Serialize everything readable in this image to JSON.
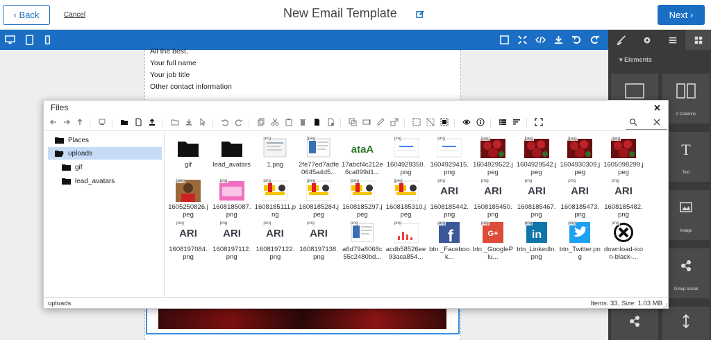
{
  "header": {
    "back_label": "‹ Back",
    "cancel_label": "Cancel",
    "title": "New Email Template",
    "next_label": "Next ›"
  },
  "email": {
    "signature_lines": [
      "All the best,",
      "Your full name",
      "Your job title",
      "Other contact information"
    ]
  },
  "right_panel": {
    "elements_header": "▾  Elements",
    "blocks": [
      {
        "label": ""
      },
      {
        "label": "2 Columns"
      },
      {
        "label": ""
      },
      {
        "label": "Text"
      },
      {
        "label": ""
      },
      {
        "label": "Image"
      },
      {
        "label": ""
      },
      {
        "label": "Group Social"
      }
    ]
  },
  "dialog": {
    "title": "Files",
    "tree": {
      "places": "Places",
      "uploads": "uploads",
      "children": [
        "gif",
        "lead_avatars"
      ]
    },
    "files": [
      {
        "name": "gif",
        "ext": "",
        "kind": "folder"
      },
      {
        "name": "lead_avatars",
        "ext": "",
        "kind": "folder"
      },
      {
        "name": "1.png",
        "ext": "png",
        "kind": "doc"
      },
      {
        "name": "2fe77ed7adfe0645a4d5...",
        "ext": "jpeg",
        "kind": "doc2"
      },
      {
        "name": "17abcf4c212e6ca099d1...",
        "ext": "",
        "kind": "ata"
      },
      {
        "name": "1604929350.png",
        "ext": "png",
        "kind": "web"
      },
      {
        "name": "1604929415.png",
        "ext": "png",
        "kind": "web"
      },
      {
        "name": "1604929522.jpeg",
        "ext": "jpeg",
        "kind": "rose"
      },
      {
        "name": "1604929542.jpeg",
        "ext": "jpeg",
        "kind": "rose"
      },
      {
        "name": "1604930309.jpeg",
        "ext": "jpeg",
        "kind": "rose"
      },
      {
        "name": "1605098299.jpeg",
        "ext": "jpeg",
        "kind": "rose"
      },
      {
        "name": "1605250826.jpeg",
        "ext": "jpeg",
        "kind": "person"
      },
      {
        "name": "1608185087.png",
        "ext": "png",
        "kind": "pink"
      },
      {
        "name": "1608185111.png",
        "ext": "png",
        "kind": "promo"
      },
      {
        "name": "1608185284.jpeg",
        "ext": "jpeg",
        "kind": "promo"
      },
      {
        "name": "1608185297.jpeg",
        "ext": "jpeg",
        "kind": "promo"
      },
      {
        "name": "1608185310.jpeg",
        "ext": "jpeg",
        "kind": "promo"
      },
      {
        "name": "1608185442.png",
        "ext": "png",
        "kind": "ari"
      },
      {
        "name": "1608185450.png",
        "ext": "png",
        "kind": "ari"
      },
      {
        "name": "1608185467.png",
        "ext": "png",
        "kind": "ari"
      },
      {
        "name": "1608185473.png",
        "ext": "png",
        "kind": "ari"
      },
      {
        "name": "1608185482.png",
        "ext": "png",
        "kind": "ari"
      },
      {
        "name": "1608197084.png",
        "ext": "png",
        "kind": "ari"
      },
      {
        "name": "1608197112.png",
        "ext": "png",
        "kind": "ari"
      },
      {
        "name": "1608197122.png",
        "ext": "png",
        "kind": "ari"
      },
      {
        "name": "1608197138.png",
        "ext": "png",
        "kind": "ari"
      },
      {
        "name": "a6d79a8068c55c2480bd...",
        "ext": "png",
        "kind": "doc2"
      },
      {
        "name": "acdb58526ee93aca854...",
        "ext": "png",
        "kind": "chart"
      },
      {
        "name": "btn _Facebook...",
        "ext": "png",
        "kind": "facebook"
      },
      {
        "name": "btn _GooglePlu...",
        "ext": "png",
        "kind": "google"
      },
      {
        "name": "btn_LinkedIn.png",
        "ext": "png",
        "kind": "linkedin"
      },
      {
        "name": "btn_Twitter.png",
        "ext": "png",
        "kind": "twitter"
      },
      {
        "name": "download-icon-black-...",
        "ext": "png",
        "kind": "xicon"
      }
    ],
    "status_left": "uploads",
    "status_right": "Items: 33, Size: 1.03 MB"
  },
  "colors": {
    "brand_blue": "#1a6fc4",
    "panel_dark": "#3a3a3a",
    "selected_tree": "#c6dcf6"
  }
}
